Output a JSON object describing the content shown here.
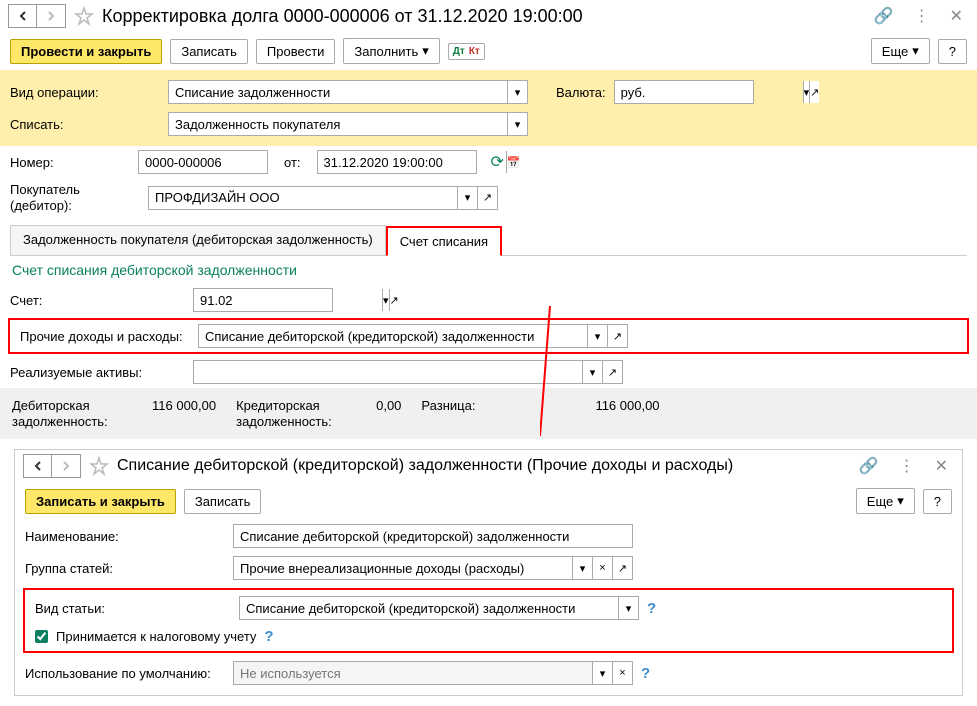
{
  "header": {
    "title": "Корректировка долга 0000-000006 от 31.12.2020 19:00:00"
  },
  "toolbar": {
    "submit_close": "Провести и закрыть",
    "save": "Записать",
    "submit": "Провести",
    "fill": "Заполнить",
    "more": "Еще",
    "help": "?"
  },
  "form": {
    "op_type_label": "Вид операции:",
    "op_type_value": "Списание задолженности",
    "currency_label": "Валюта:",
    "currency_value": "руб.",
    "writeoff_label": "Списать:",
    "writeoff_value": "Задолженность покупателя",
    "number_label": "Номер:",
    "number_value": "0000-000006",
    "from_label": "от:",
    "date_value": "31.12.2020 19:00:00",
    "buyer_label": "Покупатель (дебитор):",
    "buyer_value": "ПРОФДИЗАЙН ООО"
  },
  "tabs": {
    "tab1": "Задолженность покупателя (дебиторская задолженность)",
    "tab2": "Счет списания"
  },
  "writeoff_section": {
    "title": "Счет списания дебиторской задолженности",
    "account_label": "Счет:",
    "account_value": "91.02",
    "other_label": "Прочие доходы и расходы:",
    "other_value": "Списание дебиторской (кредиторской) задолженности",
    "assets_label": "Реализуемые активы:",
    "assets_value": ""
  },
  "totals": {
    "debit_label": "Дебиторская задолженность:",
    "debit_value": "116 000,00",
    "credit_label": "Кредиторская задолженность:",
    "credit_value": "0,00",
    "diff_label": "Разница:",
    "diff_value": "116 000,00"
  },
  "sub": {
    "title": "Списание дебиторской (кредиторской) задолженности (Прочие доходы и расходы)",
    "save_close": "Записать и закрыть",
    "save": "Записать",
    "more": "Еще",
    "help": "?",
    "name_label": "Наименование:",
    "name_value": "Списание дебиторской (кредиторской) задолженности",
    "group_label": "Группа статей:",
    "group_value": "Прочие внереализационные доходы (расходы)",
    "type_label": "Вид статьи:",
    "type_value": "Списание дебиторской (кредиторской) задолженности",
    "tax_label": "Принимается к налоговому учету",
    "usage_label": "Использование по умолчанию:",
    "usage_placeholder": "Не используется"
  }
}
